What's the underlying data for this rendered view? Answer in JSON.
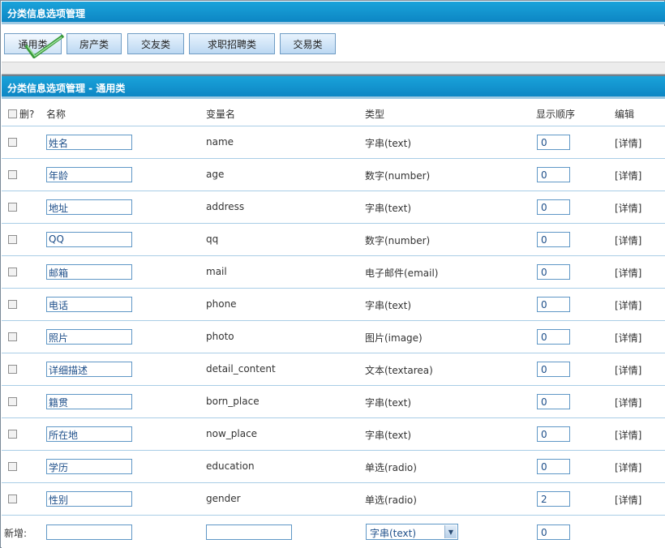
{
  "header": {
    "title": "分类信息选项管理"
  },
  "tabs": [
    {
      "label": "通用类"
    },
    {
      "label": "房产类"
    },
    {
      "label": "交友类"
    },
    {
      "label": "求职招聘类"
    },
    {
      "label": "交易类"
    }
  ],
  "section": {
    "title": "分类信息选项管理 - 通用类"
  },
  "table": {
    "headers": {
      "delete": "删?",
      "name": "名称",
      "varname": "变量名",
      "type": "类型",
      "order": "显示顺序",
      "edit": "编辑"
    },
    "rows": [
      {
        "name": "姓名",
        "varname": "name",
        "type": "字串(text)",
        "order": "0",
        "detail": "[详情]"
      },
      {
        "name": "年龄",
        "varname": "age",
        "type": "数字(number)",
        "order": "0",
        "detail": "[详情]"
      },
      {
        "name": "地址",
        "varname": "address",
        "type": "字串(text)",
        "order": "0",
        "detail": "[详情]"
      },
      {
        "name": "QQ",
        "varname": "qq",
        "type": "数字(number)",
        "order": "0",
        "detail": "[详情]"
      },
      {
        "name": "邮箱",
        "varname": "mail",
        "type": "电子邮件(email)",
        "order": "0",
        "detail": "[详情]"
      },
      {
        "name": "电话",
        "varname": "phone",
        "type": "字串(text)",
        "order": "0",
        "detail": "[详情]"
      },
      {
        "name": "照片",
        "varname": "photo",
        "type": "图片(image)",
        "order": "0",
        "detail": "[详情]"
      },
      {
        "name": "详细描述",
        "varname": "detail_content",
        "type": "文本(textarea)",
        "order": "0",
        "detail": "[详情]"
      },
      {
        "name": "籍贯",
        "varname": "born_place",
        "type": "字串(text)",
        "order": "0",
        "detail": "[详情]"
      },
      {
        "name": "所在地",
        "varname": "now_place",
        "type": "字串(text)",
        "order": "0",
        "detail": "[详情]"
      },
      {
        "name": "学历",
        "varname": "education",
        "type": "单选(radio)",
        "order": "0",
        "detail": "[详情]"
      },
      {
        "name": "性别",
        "varname": "gender",
        "type": "单选(radio)",
        "order": "2",
        "detail": "[详情]"
      }
    ],
    "new_row": {
      "label": "新增:",
      "type_selected": "字串(text)",
      "order": "0"
    }
  }
}
